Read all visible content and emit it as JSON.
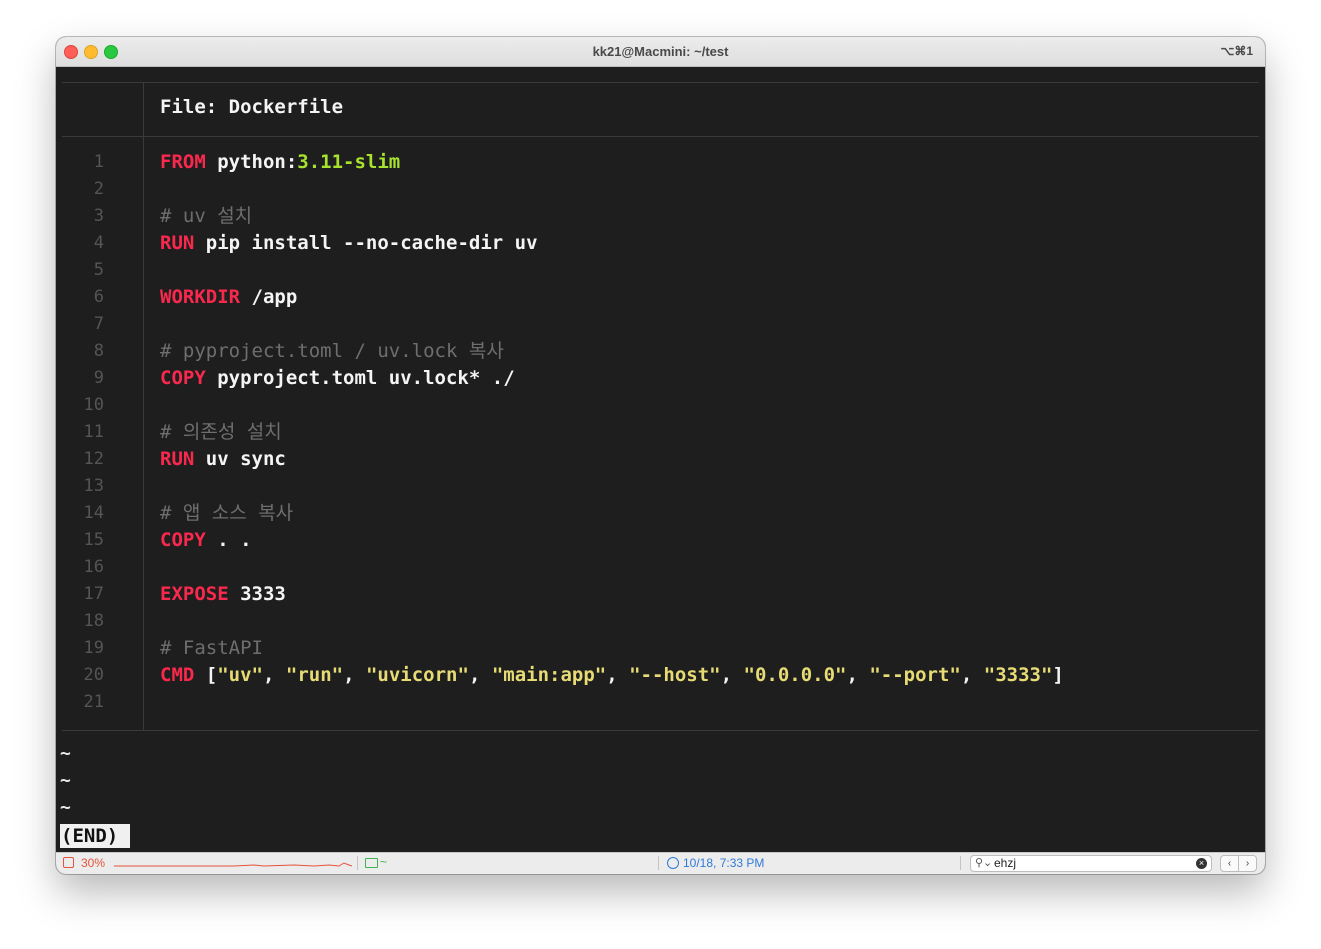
{
  "window": {
    "title": "kk21@Macmini: ~/test",
    "shortcut": "⌥⌘1"
  },
  "pager": {
    "file_header": "File: Dockerfile",
    "line_numbers": [
      "1",
      "2",
      "3",
      "4",
      "5",
      "6",
      "7",
      "8",
      "9",
      "10",
      "11",
      "12",
      "13",
      "14",
      "15",
      "16",
      "17",
      "18",
      "19",
      "20",
      "21"
    ],
    "code": {
      "l1": {
        "kw": "FROM",
        "text": "python:",
        "tag": "3.11-slim"
      },
      "l3": {
        "comment": "# uv 설치"
      },
      "l4": {
        "kw": "RUN",
        "text": "pip install --no-cache-dir uv"
      },
      "l6": {
        "kw": "WORKDIR",
        "text": "/app"
      },
      "l8": {
        "comment": "# pyproject.toml / uv.lock 복사"
      },
      "l9": {
        "kw": "COPY",
        "text": "pyproject.toml uv.lock* ./"
      },
      "l11": {
        "comment": "# 의존성 설치"
      },
      "l12": {
        "kw": "RUN",
        "text": "uv sync"
      },
      "l14": {
        "comment": "# 앱 소스 복사"
      },
      "l15": {
        "kw": "COPY",
        "text": ". ."
      },
      "l17": {
        "kw": "EXPOSE",
        "text": "3333"
      },
      "l19": {
        "comment": "# FastAPI"
      },
      "l20": {
        "kw": "CMD",
        "open": "[",
        "close": "]",
        "sep": ", ",
        "args": [
          "\"uv\"",
          "\"run\"",
          "\"uvicorn\"",
          "\"main:app\"",
          "\"--host\"",
          "\"0.0.0.0\"",
          "\"--port\"",
          "\"3333\""
        ]
      }
    },
    "tilde": "~",
    "end_marker": "(END)"
  },
  "statusbar": {
    "cpu": "30%",
    "dir": "~",
    "time": "10/18, 7:33 PM",
    "search_value": "ehzj",
    "search_icon": "magnifier-icon",
    "prev_icon": "‹",
    "next_icon": "›"
  },
  "colors": {
    "keyword": "#f9284d",
    "tag": "#a6e22e",
    "string": "#e6db74",
    "comment": "#6e6e6e",
    "cpu": "#e5533b",
    "dir": "#3fb34f",
    "time": "#2f7ad8"
  }
}
